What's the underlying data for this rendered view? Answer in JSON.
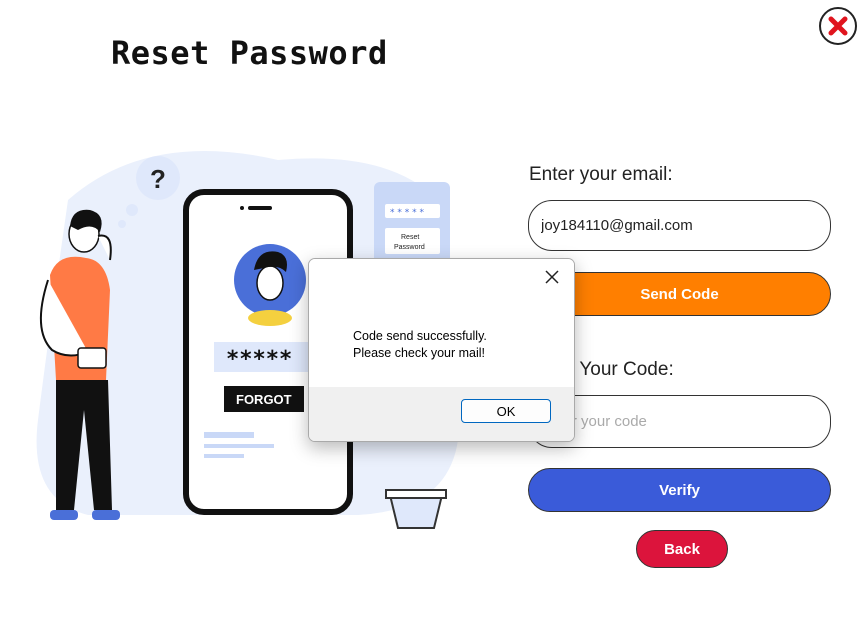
{
  "page": {
    "title": "Reset Password"
  },
  "illustration": {
    "question_mark": "?",
    "password_mask": "*****",
    "forgot_button": "FORGOT",
    "card_reset_line1": "Reset",
    "card_reset_line2": "Password"
  },
  "form": {
    "email_label": "Enter your email:",
    "email_value": "joy184110@gmail.com",
    "send_code_label": "Send Code",
    "code_label": "Enter Your Code:",
    "code_placeholder": "Enter your code",
    "verify_label": "Verify",
    "back_label": "Back"
  },
  "dialog": {
    "message_line1": "Code send successfully.",
    "message_line2": "Please check your mail!",
    "ok_label": "OK"
  },
  "colors": {
    "send_code": "#ff7f00",
    "verify": "#3a5bd9",
    "back": "#dc143c",
    "close_icon": "#e0141e",
    "illustration_blue": "#e8effc"
  },
  "icons": [
    "close-icon",
    "dialog-close-icon",
    "question-mark-icon"
  ]
}
